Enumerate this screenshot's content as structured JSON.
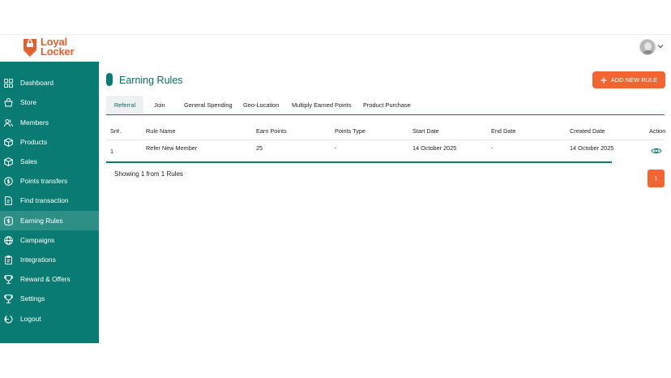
{
  "brand": {
    "line1": "Loyal",
    "line2": "Locker"
  },
  "sidebar": {
    "items": [
      {
        "label": "Dashboard",
        "icon": "dashboard-icon"
      },
      {
        "label": "Store",
        "icon": "store-icon"
      },
      {
        "label": "Members",
        "icon": "members-icon"
      },
      {
        "label": "Products",
        "icon": "box-icon"
      },
      {
        "label": "Sales",
        "icon": "sales-icon"
      },
      {
        "label": "Points transfers",
        "icon": "points-icon"
      },
      {
        "label": "Find transaction",
        "icon": "document-icon"
      },
      {
        "label": "Earning Rules",
        "icon": "earning-icon"
      },
      {
        "label": "Campaigns",
        "icon": "globe-icon"
      },
      {
        "label": "Integrations",
        "icon": "clipboard-icon"
      },
      {
        "label": "Reward & Offers",
        "icon": "reward-icon"
      },
      {
        "label": "Settings",
        "icon": "trophy-icon"
      },
      {
        "label": "Logout",
        "icon": "logout-icon"
      }
    ],
    "active": "Earning Rules"
  },
  "header": {
    "title": "Earning Rules",
    "add_button": "ADD NEW RULE"
  },
  "tabs": [
    "Referral",
    "Join",
    "General Spending",
    "Geo-Location",
    "Multiply Earned Points",
    "Product Purchase"
  ],
  "table": {
    "columns": [
      "Sr#.",
      "Rule Name",
      "Earn Points",
      "Points Type",
      "Start Date",
      "End Date",
      "Created Date",
      "Action"
    ],
    "rows": [
      [
        "1",
        "Refer New Member",
        "25",
        "-",
        "14 October 2025",
        "-",
        "14 October 2025"
      ]
    ]
  },
  "footer": {
    "showing": "Showing 1 from 1 Rules",
    "page": "1"
  },
  "colors": {
    "primary": "#0a7b72",
    "accent": "#f26532"
  }
}
